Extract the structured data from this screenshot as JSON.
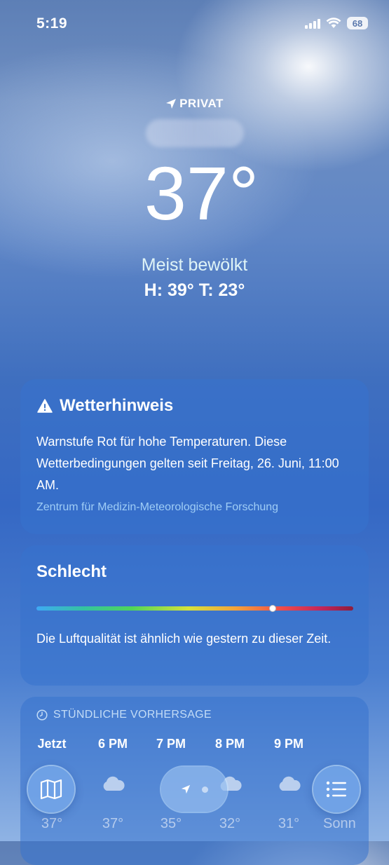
{
  "status_bar": {
    "time": "5:19",
    "battery": "68"
  },
  "header": {
    "location_label": "PRIVAT",
    "temperature": "37°",
    "condition": "Meist bewölkt",
    "high_low": "H: 39°  T: 23°"
  },
  "alert": {
    "title": "Wetterhinweis",
    "text": "Warnstufe Rot für hohe Temperaturen. Diese Wetterbedingungen gelten seit Freitag, 26. Juni, 11:00 AM.",
    "source": "Zentrum für Medizin-Meteorologische Forschung"
  },
  "air_quality": {
    "title": "Schlecht",
    "level_fraction": 0.745,
    "text": "Die Luftqualität ist ähnlich wie gestern zu dieser Zeit."
  },
  "hourly": {
    "header": "STÜNDLICHE VORHERSAGE",
    "hours": [
      {
        "label": "Jetzt",
        "icon": "cloud-icon",
        "temp": "37°"
      },
      {
        "label": "6 PM",
        "icon": "cloud-icon",
        "temp": "37°"
      },
      {
        "label": "7 PM",
        "icon": "cloud-icon",
        "temp": "35°"
      },
      {
        "label": "8 PM",
        "icon": "cloud-icon",
        "temp": "32°"
      },
      {
        "label": "9 PM",
        "icon": "cloud-icon",
        "temp": "31°"
      },
      {
        "label": "",
        "icon": "",
        "temp": "Sonn"
      }
    ]
  },
  "bottom_bar": {
    "map_icon": "map-icon",
    "location_icon": "location-arrow-icon",
    "list_icon": "list-icon"
  }
}
